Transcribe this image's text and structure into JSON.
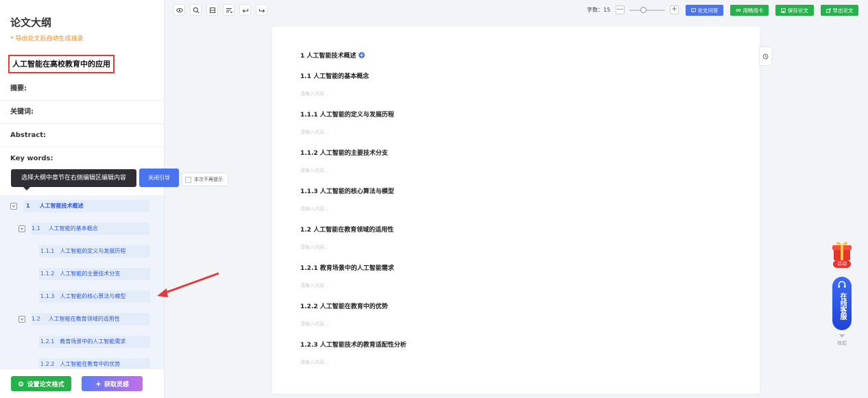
{
  "sidebar": {
    "title": "论文大纲",
    "tip": "* 导出论文后自动生成目录",
    "paper_title": "人工智能在高校教育中的应用",
    "meta": [
      {
        "label": "摘要:"
      },
      {
        "label": "关键词:"
      },
      {
        "label": "Abstract:"
      },
      {
        "label": "Key words:"
      }
    ],
    "outline": [
      {
        "num": "1",
        "label": "人工智能技术概述",
        "level": 1
      },
      {
        "num": "1.1",
        "label": "人工智能的基本概念",
        "level": 2
      },
      {
        "num": "1.1.1",
        "label": "人工智能的定义与发展历程",
        "level": 3
      },
      {
        "num": "1.1.2",
        "label": "人工智能的主要技术分支",
        "level": 3
      },
      {
        "num": "1.1.3",
        "label": "人工智能的核心算法与模型",
        "level": 3
      },
      {
        "num": "1.2",
        "label": "人工智能在教育领域的适用性",
        "level": 2
      },
      {
        "num": "1.2.1",
        "label": "教育场景中的人工智能需求",
        "level": 3
      },
      {
        "num": "1.2.2",
        "label": "人工智能在教育中的优势",
        "level": 3
      }
    ],
    "btn_format": "设置论文格式",
    "btn_idea": "获取灵感"
  },
  "guide": {
    "tip": "选择大纲中章节在右侧编辑区编辑内容",
    "close": "关闭引导",
    "no_remind": "本次不再提示"
  },
  "toolbar": {
    "icons": [
      "eye-icon",
      "search-icon",
      "layout-icon",
      "list-icon",
      "undo-icon",
      "redo-icon"
    ],
    "wordcount_label": "字数：",
    "wordcount_value": "15",
    "zoom_minus": "—",
    "zoom_plus": "+",
    "zoom_level": 0.4,
    "btn_qa": "论文问答",
    "btn_card": "用畅用卡",
    "btn_save": "保存论文",
    "btn_export": "导出论文",
    "colors": {
      "qa": "#4a73f0",
      "card": "#25b24a",
      "save": "#25b24a",
      "export": "#25b24a"
    }
  },
  "editor": {
    "placeholder": "请输入内容...",
    "headings": [
      {
        "text": "1 人工智能技术概述",
        "has_placeholder": false,
        "has_add": true
      },
      {
        "text": "1.1 人工智能的基本概念",
        "has_placeholder": true
      },
      {
        "text": "1.1.1 人工智能的定义与发展历程",
        "has_placeholder": true
      },
      {
        "text": "1.1.2 人工智能的主要技术分支",
        "has_placeholder": true
      },
      {
        "text": "1.1.3 人工智能的核心算法与模型",
        "has_placeholder": true
      },
      {
        "text": "1.2 人工智能在教育领域的适用性",
        "has_placeholder": true
      },
      {
        "text": "1.2.1 教育场景中的人工智能需求",
        "has_placeholder": true
      },
      {
        "text": "1.2.2 人工智能在教育中的优势",
        "has_placeholder": true
      },
      {
        "text": "1.2.3 人工智能技术的教育适配性分析",
        "has_placeholder": true
      }
    ]
  },
  "floaters": {
    "gift_label": "活动",
    "support_label": "在线客服",
    "collapse_label": "收起"
  }
}
